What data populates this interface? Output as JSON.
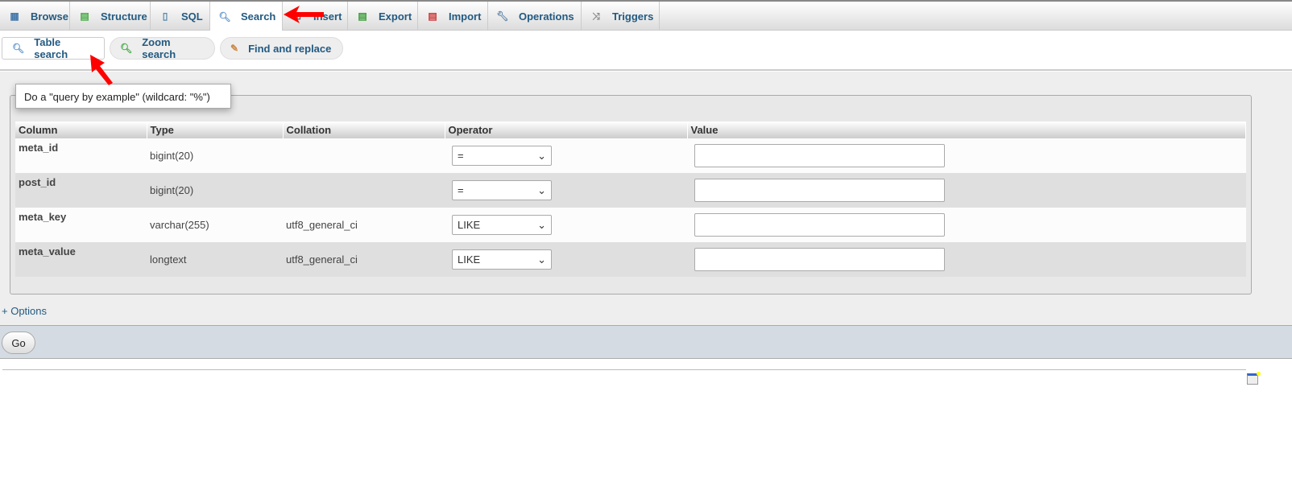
{
  "tabs": [
    {
      "label": "Browse",
      "icon": "table-icon",
      "active": false
    },
    {
      "label": "Structure",
      "icon": "structure-icon",
      "active": false
    },
    {
      "label": "SQL",
      "icon": "sql-scroll-icon",
      "active": false
    },
    {
      "label": "Search",
      "icon": "magnifier-icon",
      "active": true
    },
    {
      "label": "Insert",
      "icon": "insert-icon",
      "active": false
    },
    {
      "label": "Export",
      "icon": "export-icon",
      "active": false
    },
    {
      "label": "Import",
      "icon": "import-icon",
      "active": false
    },
    {
      "label": "Operations",
      "icon": "wrench-icon",
      "active": false
    },
    {
      "label": "Triggers",
      "icon": "triggers-icon",
      "active": false
    }
  ],
  "subtabs": [
    {
      "label": "Table search",
      "icon": "magnifier-icon",
      "active": true
    },
    {
      "label": "Zoom search",
      "icon": "zoom-search-icon",
      "active": false
    },
    {
      "label": "Find and replace",
      "icon": "find-replace-icon",
      "active": false
    }
  ],
  "tooltip": "Do a \"query by example\" (wildcard: \"%\")",
  "table": {
    "headers": [
      "Column",
      "Type",
      "Collation",
      "Operator",
      "Value"
    ],
    "rows": [
      {
        "column": "meta_id",
        "type": "bigint(20)",
        "collation": "",
        "operator": "=",
        "value": ""
      },
      {
        "column": "post_id",
        "type": "bigint(20)",
        "collation": "",
        "operator": "=",
        "value": ""
      },
      {
        "column": "meta_key",
        "type": "varchar(255)",
        "collation": "utf8_general_ci",
        "operator": "LIKE",
        "value": ""
      },
      {
        "column": "meta_value",
        "type": "longtext",
        "collation": "utf8_general_ci",
        "operator": "LIKE",
        "value": ""
      }
    ]
  },
  "options_link": "+ Options",
  "go_button": "Go",
  "colors": {
    "link": "#235a81",
    "annotation_arrow": "#ff0000",
    "go_bar": "#d4dbe3"
  }
}
